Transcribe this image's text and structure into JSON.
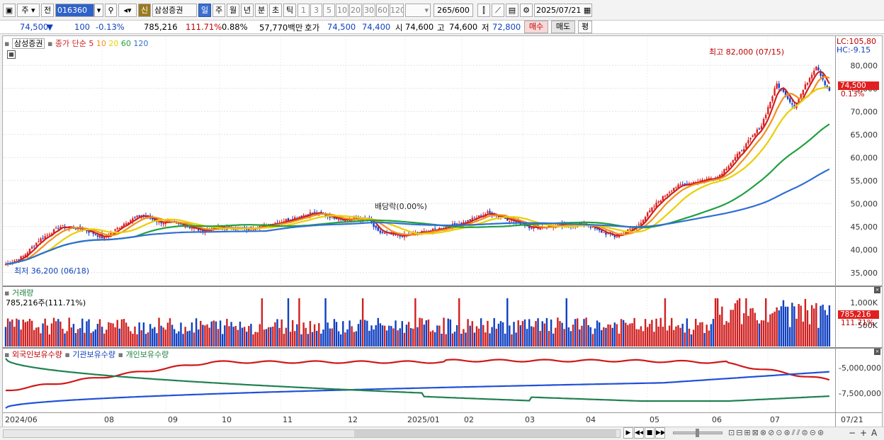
{
  "toolbar": {
    "market": "주",
    "prev": "전",
    "code": "016360",
    "credit": "신",
    "stock_name": "삼성증권",
    "periods": [
      "일",
      "주",
      "월",
      "년",
      "분",
      "초",
      "틱"
    ],
    "numbers": [
      "1",
      "3",
      "5",
      "10",
      "20",
      "30",
      "60",
      "120"
    ],
    "count": "265",
    "total": "/600",
    "date": "2025/07/21"
  },
  "quote": {
    "price": "74,500",
    "change": "100",
    "pct": "-0.13%",
    "volume": "785,216",
    "vol_ratio": "111.71%",
    "turnover": "0.88%",
    "amount": "57,770백만",
    "hoga_label": "호가",
    "ask": "74,500",
    "bid": "74,400",
    "open_label": "시",
    "open": "74,600",
    "high_label": "고",
    "high": "74,600",
    "low_label": "저",
    "low": "72,800",
    "buy": "매수",
    "sell": "매도",
    "eval": "평"
  },
  "price_panel": {
    "name": "삼성증권",
    "ma_title": "종가 단순",
    "ma": [
      {
        "p": "5",
        "color": "#d02020"
      },
      {
        "p": "10",
        "color": "#f09020"
      },
      {
        "p": "20",
        "color": "#e8d000"
      },
      {
        "p": "60",
        "color": "#20a040"
      },
      {
        "p": "120",
        "color": "#3070d0"
      }
    ],
    "lc": "LC:105,80",
    "hc": "HC:-9.15",
    "cur_price": "74,500",
    "cur_pct": "0.13%",
    "high_ann": "최고 82,000 (07/15)",
    "low_ann": "최저 36,200 (06/18)",
    "div_ann": "배당락(0.00%)"
  },
  "volume_panel": {
    "title": "거래량",
    "value": "785,216주(111.71%)",
    "cur": "785,216",
    "cur_pct": "111.71%"
  },
  "holder_panel": {
    "foreign": "외국인보유수량",
    "inst": "기관보유수량",
    "indiv": "개인보유수량"
  },
  "chart_data": {
    "type": "candlestick",
    "price_ticks": [
      35000,
      40000,
      45000,
      50000,
      55000,
      60000,
      65000,
      70000,
      75000,
      80000
    ],
    "price_tick_labels": [
      "35,000",
      "40,000",
      "45,000",
      "50,000",
      "55,000",
      "60,000",
      "65,000",
      "70,000",
      "75,000",
      "80,000"
    ],
    "price_range": [
      32500,
      84500
    ],
    "volume_ticks": [
      "1,000K",
      "500K"
    ],
    "holder_ticks": [
      "-5,000,000",
      "-7,500,000"
    ],
    "date_labels": [
      "2024/06",
      "08",
      "09",
      "10",
      "11",
      "12",
      "2025/01",
      "02",
      "03",
      "04",
      "05",
      "06",
      "07",
      "07/21"
    ],
    "close_keypoints": [
      [
        0,
        36800
      ],
      [
        8,
        38500
      ],
      [
        15,
        42000
      ],
      [
        25,
        45000
      ],
      [
        35,
        44500
      ],
      [
        45,
        42500
      ],
      [
        55,
        46000
      ],
      [
        62,
        47500
      ],
      [
        70,
        46000
      ],
      [
        80,
        45500
      ],
      [
        90,
        44000
      ],
      [
        95,
        44800
      ],
      [
        110,
        44500
      ],
      [
        125,
        46000
      ],
      [
        140,
        48000
      ],
      [
        155,
        46500
      ],
      [
        165,
        46800
      ],
      [
        170,
        43800
      ],
      [
        180,
        42900
      ],
      [
        195,
        44200
      ],
      [
        210,
        46000
      ],
      [
        220,
        48000
      ],
      [
        230,
        46500
      ],
      [
        240,
        44800
      ],
      [
        255,
        45200
      ],
      [
        265,
        45500
      ],
      [
        270,
        44200
      ],
      [
        278,
        42800
      ],
      [
        288,
        45000
      ],
      [
        298,
        50500
      ],
      [
        305,
        53500
      ],
      [
        315,
        54800
      ],
      [
        325,
        55800
      ],
      [
        335,
        61000
      ],
      [
        345,
        67000
      ],
      [
        352,
        76000
      ],
      [
        360,
        71000
      ],
      [
        366,
        76500
      ],
      [
        370,
        80000
      ],
      [
        374,
        76000
      ],
      [
        376,
        74500
      ]
    ]
  }
}
